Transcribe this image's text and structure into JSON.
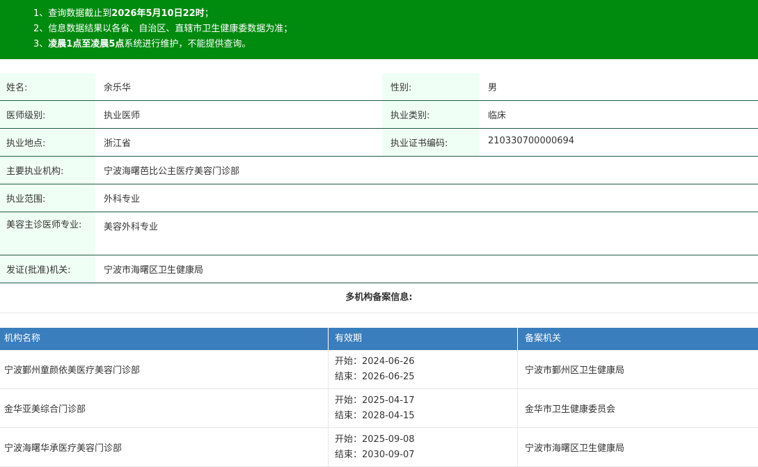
{
  "notice": {
    "line1_prefix": "1、查询数据截止到",
    "line1_bold": "2026年5月10日22时",
    "line1_suffix": "；",
    "line2": "2、信息数据结果以各省、自治区、直辖市卫生健康委数据为准；",
    "line3_prefix": "3、",
    "line3_bold": "凌晨1点至凌晨5点",
    "line3_suffix": "系统进行维护，不能提供查询。"
  },
  "profile": {
    "name_label": "姓名:",
    "name_value": "余乐华",
    "gender_label": "性别:",
    "gender_value": "男",
    "level_label": "医师级别:",
    "level_value": "执业医师",
    "category_label": "执业类别:",
    "category_value": "临床",
    "location_label": "执业地点:",
    "location_value": "浙江省",
    "cert_label": "执业证书编码:",
    "cert_value": "210330700000694",
    "org_label": "主要执业机构:",
    "org_value": "宁波海曙芭比公主医疗美容门诊部",
    "scope_label": "执业范围:",
    "scope_value": "外科专业",
    "beauty_label": "美容主诊医师专业:",
    "beauty_value": "美容外科专业",
    "issuer_label": "发证(批准)机关:",
    "issuer_value": "宁波市海曙区卫生健康局"
  },
  "multi": {
    "title": "多机构备案信息:",
    "columns": [
      "机构名称",
      "有效期",
      "备案机关"
    ],
    "rows": [
      {
        "org": "宁波鄞州童颜依美医疗美容门诊部",
        "start": "开始：2024-06-26",
        "end": "结束：2026-06-25",
        "authority": "宁波市鄞州区卫生健康局"
      },
      {
        "org": "金华亚美综合门诊部",
        "start": "开始：2025-04-17",
        "end": "结束：2028-04-15",
        "authority": "金华市卫生健康委员会"
      },
      {
        "org": "宁波海曙华承医疗美容门诊部",
        "start": "开始：2025-09-08",
        "end": "结束：2030-09-07",
        "authority": "宁波市海曙区卫生健康局"
      }
    ]
  }
}
